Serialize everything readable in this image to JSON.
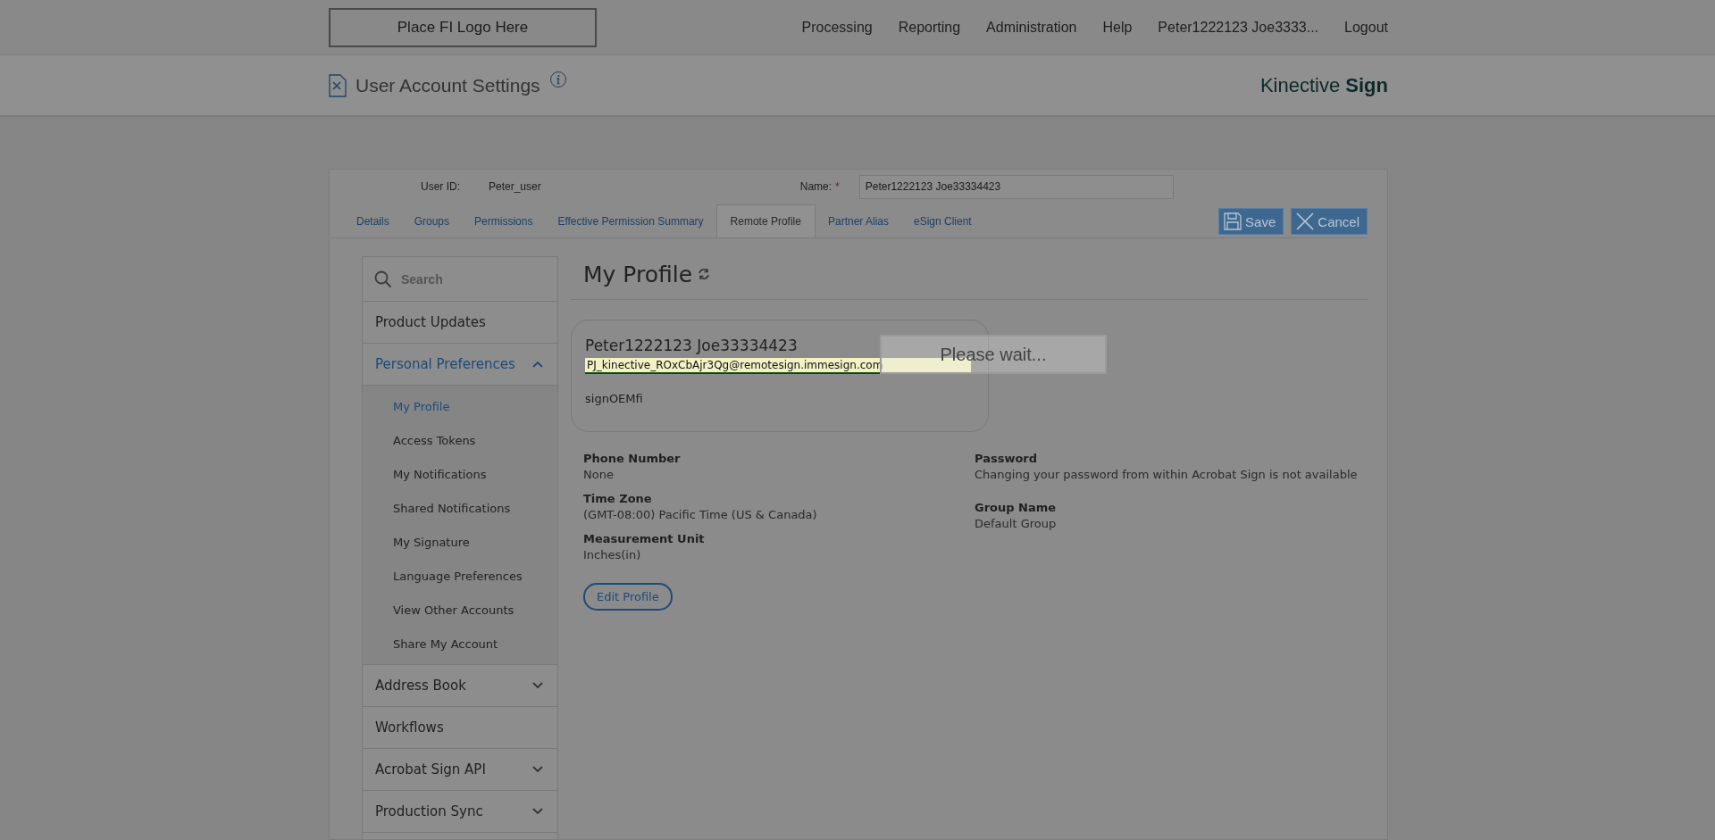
{
  "header": {
    "logo_placeholder": "Place FI Logo Here",
    "nav": [
      "Processing",
      "Reporting",
      "Administration",
      "Help",
      "Peter1222123 Joe3333...",
      "Logout"
    ]
  },
  "subheader": {
    "title": "User Account Settings",
    "brand": "Kinective **Sign**"
  },
  "user": {
    "user_id_label": "User ID:",
    "user_id": "Peter_user",
    "name_label": "Name:",
    "required_mark": "*",
    "name_value": "Peter1222123 Joe33334423"
  },
  "tabs": [
    {
      "label": "Details",
      "selected": false
    },
    {
      "label": "Groups",
      "selected": false
    },
    {
      "label": "Permissions",
      "selected": false
    },
    {
      "label": "Effective Permission Summary",
      "selected": false
    },
    {
      "label": "Remote Profile",
      "selected": true
    },
    {
      "label": "Partner Alias",
      "selected": false
    },
    {
      "label": "eSign Client",
      "selected": false
    }
  ],
  "buttons": [
    {
      "kind": "save",
      "label": "Save"
    },
    {
      "kind": "cancel",
      "label": "Cancel"
    }
  ],
  "sidebar": {
    "search_placeholder": "Search",
    "items": [
      {
        "kind": "link",
        "label": "Product Updates",
        "selected": false
      },
      {
        "kind": "group",
        "label": "Personal Preferences",
        "selected": true,
        "expanded": true,
        "children": [
          {
            "label": "My Profile",
            "selected": true
          },
          {
            "label": "Access Tokens",
            "selected": false
          },
          {
            "label": "My Notifications",
            "selected": false
          },
          {
            "label": "Shared Notifications",
            "selected": false
          },
          {
            "label": "My Signature",
            "selected": false
          },
          {
            "label": "Language Preferences",
            "selected": false
          },
          {
            "label": "View Other Accounts",
            "selected": false
          },
          {
            "label": "Share My Account",
            "selected": false
          }
        ]
      },
      {
        "kind": "group",
        "label": "Address Book",
        "selected": false,
        "expanded": false
      },
      {
        "kind": "link",
        "label": "Workflows",
        "selected": false
      },
      {
        "kind": "group",
        "label": "Acrobat Sign API",
        "selected": false,
        "expanded": false
      },
      {
        "kind": "group",
        "label": "Production Sync",
        "selected": false,
        "expanded": false
      }
    ]
  },
  "profile": {
    "heading": "My Profile",
    "card": {
      "name": "Peter1222123 Joe33334423",
      "email": "PJ_kinective_ROxCbAjr3Qg@remotesign.immesign.com",
      "account": "signOEMfi"
    },
    "left_fields": [
      {
        "label": "Phone Number",
        "value": "None"
      },
      {
        "label": "Time Zone",
        "value": "(GMT-08:00) Pacific Time (US & Canada)"
      },
      {
        "label": "Measurement Unit",
        "value": "Inches(in)"
      }
    ],
    "right_fields": [
      {
        "label": "Password",
        "value": "Changing your password from within Acrobat Sign is not available"
      },
      {
        "label": "Group Name",
        "value": "Default Group"
      }
    ],
    "edit_button": "Edit Profile"
  },
  "loading": {
    "message": "Please wait..."
  }
}
